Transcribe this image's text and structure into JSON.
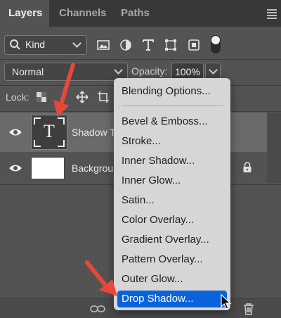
{
  "tabs": [
    {
      "label": "Layers",
      "active": true
    },
    {
      "label": "Channels",
      "active": false
    },
    {
      "label": "Paths",
      "active": false
    }
  ],
  "filter": {
    "kind_label": "Kind",
    "icons": [
      "image-filter-icon",
      "adjustment-filter-icon",
      "type-filter-icon",
      "shape-filter-icon",
      "smart-object-filter-icon",
      "filter-toggle"
    ]
  },
  "blend": {
    "mode": "Normal",
    "opacity_label": "Opacity:",
    "opacity_value": "100%"
  },
  "lock": {
    "label": "Lock:"
  },
  "layers": [
    {
      "name": "Shadow T",
      "type": "text",
      "selected": true
    },
    {
      "name": "Backgrou",
      "type": "background",
      "locked": true
    }
  ],
  "context_menu": {
    "header": "Blending Options...",
    "items": [
      "Bevel & Emboss...",
      "Stroke...",
      "Inner Shadow...",
      "Inner Glow...",
      "Satin...",
      "Color Overlay...",
      "Gradient Overlay...",
      "Pattern Overlay...",
      "Outer Glow...",
      "Drop Shadow..."
    ],
    "highlighted": "Drop Shadow..."
  },
  "colors": {
    "panel_bg": "#535353",
    "menu_bg": "#d6d6d6",
    "highlight": "#0a63d8",
    "annotation_arrow": "#e8473a"
  }
}
